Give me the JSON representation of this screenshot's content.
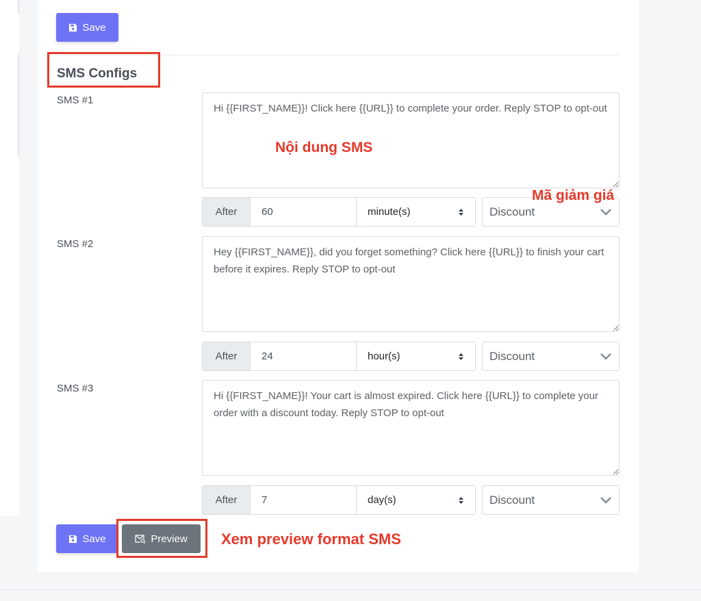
{
  "toolbar": {
    "save_label": "Save"
  },
  "section": {
    "title": "SMS Configs"
  },
  "sms": [
    {
      "label": "SMS #1",
      "text": "Hi {{FIRST_NAME}}! Click here {{URL}} to complete your order. Reply STOP to opt-out",
      "after_label": "After",
      "value": "60",
      "unit": "minute(s)",
      "discount": "Discount"
    },
    {
      "label": "SMS #2",
      "text": "Hey {{FIRST_NAME}}, did you forget something? Click here {{URL}} to finish your cart before it expires. Reply STOP to opt-out",
      "after_label": "After",
      "value": "24",
      "unit": "hour(s)",
      "discount": "Discount"
    },
    {
      "label": "SMS #3",
      "text": "Hi {{FIRST_NAME}}! Your cart is almost expired. Click here {{URL}} to complete your order with a discount today. Reply STOP to opt-out",
      "after_label": "After",
      "value": "7",
      "unit": "day(s)",
      "discount": "Discount"
    }
  ],
  "footer": {
    "save_label": "Save",
    "preview_label": "Preview"
  },
  "annotations": {
    "content": "Nội dung SMS",
    "discount": "Mã giảm giá",
    "preview": "Xem preview format SMS"
  },
  "colors": {
    "primary": "#6e73f5",
    "secondary": "#6c757d",
    "annotation": "#e53a2b"
  },
  "icons": {
    "save": "floppy-disk-icon",
    "preview": "envelope-search-icon",
    "select": "up-down-caret-icon",
    "dropdown": "chevron-down-icon",
    "resize": "resize-handle-icon"
  }
}
